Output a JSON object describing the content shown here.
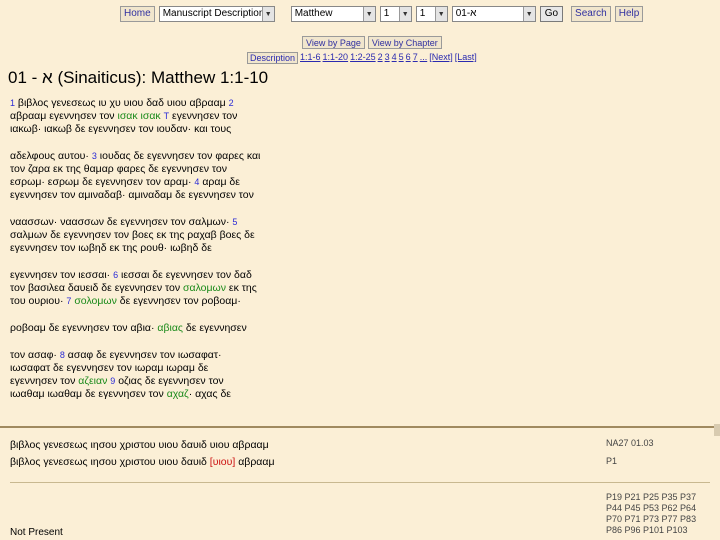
{
  "toolbar": {
    "home": "Home",
    "description_select": "Manuscript Descriptions",
    "book_select": "Matthew",
    "chapter_select": "1",
    "verse_select": "1",
    "manuscript_select": "א-01",
    "go": "Go",
    "search": "Search",
    "help": "Help"
  },
  "view": {
    "by_page": "View by Page",
    "by_chapter": "View by Chapter"
  },
  "pager": [
    "Description",
    "1:1-6",
    "1:1-20",
    "1:2-25",
    "2",
    "3",
    "4",
    "5",
    "6",
    "7",
    "...",
    "[Next]",
    "[Last]"
  ],
  "title": "א - 01 (Sinaiticus): Matthew 1:1-10",
  "lines": [
    [
      [
        "v",
        "1"
      ],
      [
        "t",
        " βιβλος γενεσεως ιυ χυ υιου δαδ υιου αβρααμ "
      ],
      [
        "v",
        "2"
      ]
    ],
    [
      [
        "t",
        "αβρααμ εγεννησεν τον "
      ],
      [
        "g",
        "ισακ ισακ"
      ],
      [
        "t",
        " "
      ],
      [
        "v",
        "T"
      ],
      [
        "t",
        " εγεννησεν τον"
      ]
    ],
    [
      [
        "t",
        "ιακωβ· ιακωβ δε εγεννησεν τον ιουδαν· και τους"
      ]
    ],
    [
      [
        "gap",
        ""
      ]
    ],
    [
      [
        "t",
        "αδελφους αυτου· "
      ],
      [
        "v",
        "3"
      ],
      [
        "t",
        " ιουδας δε εγεννησεν τον φαρες και"
      ]
    ],
    [
      [
        "t",
        "τον ζαρα εκ της θαμαρ φαρες δε εγεννησεν τον"
      ]
    ],
    [
      [
        "t",
        "εσρωμ· εσρωμ δε εγεννησεν τον αραμ· "
      ],
      [
        "v",
        "4"
      ],
      [
        "t",
        " αραμ δε"
      ]
    ],
    [
      [
        "t",
        "εγεννησεν τον αμιναδαβ· αμιναδαμ δε εγεννησεν τον"
      ]
    ],
    [
      [
        "gap",
        ""
      ]
    ],
    [
      [
        "t",
        "ναασσων· ναασσων δε εγεννησεν τον σαλμων· "
      ],
      [
        "v",
        "5"
      ]
    ],
    [
      [
        "t",
        "σαλμων δε εγεννησεν τον βοες εκ της ραχαβ βοες δε"
      ]
    ],
    [
      [
        "t",
        "εγεννησεν τον ιωβηδ εκ της ρουθ· ιωβηδ δε"
      ]
    ],
    [
      [
        "gap",
        ""
      ]
    ],
    [
      [
        "t",
        "εγεννησεν τον ιεσσαι· "
      ],
      [
        "v",
        "6"
      ],
      [
        "t",
        " ιεσσαι δε εγεννησεν τον δαδ"
      ]
    ],
    [
      [
        "t",
        "τον βασιλεα δαυειδ δε εγεννησεν τον "
      ],
      [
        "g",
        "σαλομων"
      ],
      [
        "t",
        " εκ της"
      ]
    ],
    [
      [
        "t",
        "του ουριου· "
      ],
      [
        "v",
        "7"
      ],
      [
        "t",
        " "
      ],
      [
        "g",
        "σολομων"
      ],
      [
        "t",
        " δε εγεννησεν τον ροβοαμ·"
      ]
    ],
    [
      [
        "gap",
        ""
      ]
    ],
    [
      [
        "t",
        "ροβοαμ δε εγεννησεν τον αβια· "
      ],
      [
        "g",
        "αβιας"
      ],
      [
        "t",
        " δε εγεννησεν"
      ]
    ],
    [
      [
        "gap",
        ""
      ]
    ],
    [
      [
        "t",
        "τον ασαφ· "
      ],
      [
        "v",
        "8"
      ],
      [
        "t",
        " ασαφ δε εγεννησεν τον ιωσαφατ·"
      ]
    ],
    [
      [
        "t",
        "ιωσαφατ δε εγεννησεν τον ιωραμ ιωραμ δε"
      ]
    ],
    [
      [
        "t",
        "εγεννησεν τον "
      ],
      [
        "g",
        "αζειαν"
      ],
      [
        "t",
        " "
      ],
      [
        "v",
        "9"
      ],
      [
        "t",
        " οζιας δε εγεννησεν τον"
      ]
    ],
    [
      [
        "t",
        "ιωαθαμ ιωαθαμ δε εγεννησεν τον "
      ],
      [
        "g",
        "αχαζ"
      ],
      [
        "t",
        "· αχας δε"
      ]
    ]
  ],
  "compare": {
    "line1": "βιβλος γενεσεως ιησου χριστου υιου δαυιδ υιου αβρααμ",
    "line2_before": "βιβλος γενεσεως ιησου χριστου υιου δαυιδ ",
    "line2_red": "[υιου]",
    "line2_after": " αβρααμ",
    "src1": "NA27 01.03",
    "src2": "P1",
    "papyri": [
      "P19 P21 P25 P35 P37",
      "P44 P45 P53 P62 P64",
      "P70 P71 P73 P77 P83",
      "P86 P96 P101 P103"
    ],
    "not_present": "Not Present"
  }
}
